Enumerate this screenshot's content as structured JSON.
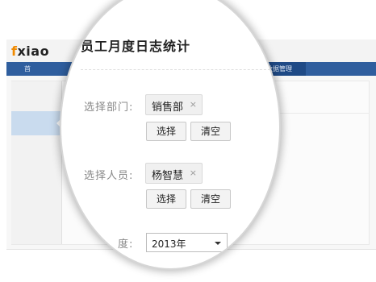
{
  "background": {
    "logo": {
      "first_letter": "f",
      "rest": "xiao"
    },
    "nav": {
      "first_item": "首",
      "active_item": "数据管理"
    }
  },
  "form": {
    "title": "员工月度日志统计",
    "department": {
      "label": "选择部门:",
      "selected_tag": "销售部",
      "remove_symbol": "×",
      "select_button": "选择",
      "clear_button": "清空"
    },
    "personnel": {
      "label": "选择人员:",
      "selected_tag": "杨智慧",
      "remove_symbol": "×",
      "select_button": "选择",
      "clear_button": "清空"
    },
    "month": {
      "label": "月　　度:",
      "value": "2013年"
    }
  },
  "colors": {
    "nav_bar": "#2f5e9e",
    "nav_active": "#1f4a86",
    "logo_accent": "#f08a00",
    "sidebar_selected": "#c9dbee"
  }
}
